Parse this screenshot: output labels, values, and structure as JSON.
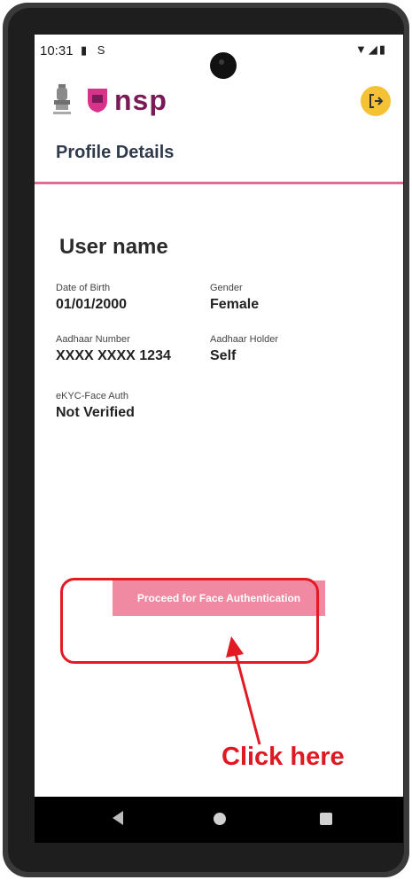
{
  "status_bar": {
    "time": "10:31",
    "left_icons": "▮ S",
    "right_icons": "▼◢▮"
  },
  "header": {
    "logo_text": "nsp",
    "logout_icon": "logout-icon",
    "accent_color": "#f6c235",
    "brand_color": "#7a1a57"
  },
  "page": {
    "title": "Profile Details"
  },
  "profile": {
    "user_name": "User name",
    "dob_label": "Date of Birth",
    "dob_value": "01/01/2000",
    "gender_label": "Gender",
    "gender_value": "Female",
    "aadhaar_label": "Aadhaar Number",
    "aadhaar_value": "XXXX XXXX 1234",
    "holder_label": "Aadhaar Holder",
    "holder_value": "Self",
    "ekyc_label": "eKYC-Face Auth",
    "ekyc_value": "Not Verified"
  },
  "actions": {
    "proceed_label": "Proceed for Face Authentication",
    "button_color": "#f08aa2"
  },
  "annotation": {
    "click_here": "Click here",
    "color": "#e11a24"
  }
}
